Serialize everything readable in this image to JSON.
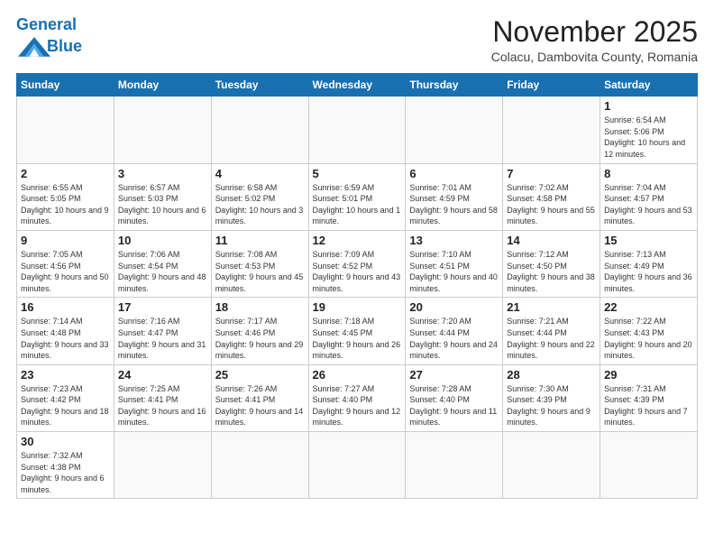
{
  "header": {
    "logo_general": "General",
    "logo_blue": "Blue",
    "month_title": "November 2025",
    "location": "Colacu, Dambovita County, Romania"
  },
  "days_of_week": [
    "Sunday",
    "Monday",
    "Tuesday",
    "Wednesday",
    "Thursday",
    "Friday",
    "Saturday"
  ],
  "weeks": [
    [
      {
        "day": "",
        "info": ""
      },
      {
        "day": "",
        "info": ""
      },
      {
        "day": "",
        "info": ""
      },
      {
        "day": "",
        "info": ""
      },
      {
        "day": "",
        "info": ""
      },
      {
        "day": "",
        "info": ""
      },
      {
        "day": "1",
        "info": "Sunrise: 6:54 AM\nSunset: 5:06 PM\nDaylight: 10 hours and 12 minutes."
      }
    ],
    [
      {
        "day": "2",
        "info": "Sunrise: 6:55 AM\nSunset: 5:05 PM\nDaylight: 10 hours and 9 minutes."
      },
      {
        "day": "3",
        "info": "Sunrise: 6:57 AM\nSunset: 5:03 PM\nDaylight: 10 hours and 6 minutes."
      },
      {
        "day": "4",
        "info": "Sunrise: 6:58 AM\nSunset: 5:02 PM\nDaylight: 10 hours and 3 minutes."
      },
      {
        "day": "5",
        "info": "Sunrise: 6:59 AM\nSunset: 5:01 PM\nDaylight: 10 hours and 1 minute."
      },
      {
        "day": "6",
        "info": "Sunrise: 7:01 AM\nSunset: 4:59 PM\nDaylight: 9 hours and 58 minutes."
      },
      {
        "day": "7",
        "info": "Sunrise: 7:02 AM\nSunset: 4:58 PM\nDaylight: 9 hours and 55 minutes."
      },
      {
        "day": "8",
        "info": "Sunrise: 7:04 AM\nSunset: 4:57 PM\nDaylight: 9 hours and 53 minutes."
      }
    ],
    [
      {
        "day": "9",
        "info": "Sunrise: 7:05 AM\nSunset: 4:56 PM\nDaylight: 9 hours and 50 minutes."
      },
      {
        "day": "10",
        "info": "Sunrise: 7:06 AM\nSunset: 4:54 PM\nDaylight: 9 hours and 48 minutes."
      },
      {
        "day": "11",
        "info": "Sunrise: 7:08 AM\nSunset: 4:53 PM\nDaylight: 9 hours and 45 minutes."
      },
      {
        "day": "12",
        "info": "Sunrise: 7:09 AM\nSunset: 4:52 PM\nDaylight: 9 hours and 43 minutes."
      },
      {
        "day": "13",
        "info": "Sunrise: 7:10 AM\nSunset: 4:51 PM\nDaylight: 9 hours and 40 minutes."
      },
      {
        "day": "14",
        "info": "Sunrise: 7:12 AM\nSunset: 4:50 PM\nDaylight: 9 hours and 38 minutes."
      },
      {
        "day": "15",
        "info": "Sunrise: 7:13 AM\nSunset: 4:49 PM\nDaylight: 9 hours and 36 minutes."
      }
    ],
    [
      {
        "day": "16",
        "info": "Sunrise: 7:14 AM\nSunset: 4:48 PM\nDaylight: 9 hours and 33 minutes."
      },
      {
        "day": "17",
        "info": "Sunrise: 7:16 AM\nSunset: 4:47 PM\nDaylight: 9 hours and 31 minutes."
      },
      {
        "day": "18",
        "info": "Sunrise: 7:17 AM\nSunset: 4:46 PM\nDaylight: 9 hours and 29 minutes."
      },
      {
        "day": "19",
        "info": "Sunrise: 7:18 AM\nSunset: 4:45 PM\nDaylight: 9 hours and 26 minutes."
      },
      {
        "day": "20",
        "info": "Sunrise: 7:20 AM\nSunset: 4:44 PM\nDaylight: 9 hours and 24 minutes."
      },
      {
        "day": "21",
        "info": "Sunrise: 7:21 AM\nSunset: 4:44 PM\nDaylight: 9 hours and 22 minutes."
      },
      {
        "day": "22",
        "info": "Sunrise: 7:22 AM\nSunset: 4:43 PM\nDaylight: 9 hours and 20 minutes."
      }
    ],
    [
      {
        "day": "23",
        "info": "Sunrise: 7:23 AM\nSunset: 4:42 PM\nDaylight: 9 hours and 18 minutes."
      },
      {
        "day": "24",
        "info": "Sunrise: 7:25 AM\nSunset: 4:41 PM\nDaylight: 9 hours and 16 minutes."
      },
      {
        "day": "25",
        "info": "Sunrise: 7:26 AM\nSunset: 4:41 PM\nDaylight: 9 hours and 14 minutes."
      },
      {
        "day": "26",
        "info": "Sunrise: 7:27 AM\nSunset: 4:40 PM\nDaylight: 9 hours and 12 minutes."
      },
      {
        "day": "27",
        "info": "Sunrise: 7:28 AM\nSunset: 4:40 PM\nDaylight: 9 hours and 11 minutes."
      },
      {
        "day": "28",
        "info": "Sunrise: 7:30 AM\nSunset: 4:39 PM\nDaylight: 9 hours and 9 minutes."
      },
      {
        "day": "29",
        "info": "Sunrise: 7:31 AM\nSunset: 4:39 PM\nDaylight: 9 hours and 7 minutes."
      }
    ],
    [
      {
        "day": "30",
        "info": "Sunrise: 7:32 AM\nSunset: 4:38 PM\nDaylight: 9 hours and 6 minutes."
      },
      {
        "day": "",
        "info": ""
      },
      {
        "day": "",
        "info": ""
      },
      {
        "day": "",
        "info": ""
      },
      {
        "day": "",
        "info": ""
      },
      {
        "day": "",
        "info": ""
      },
      {
        "day": "",
        "info": ""
      }
    ]
  ]
}
